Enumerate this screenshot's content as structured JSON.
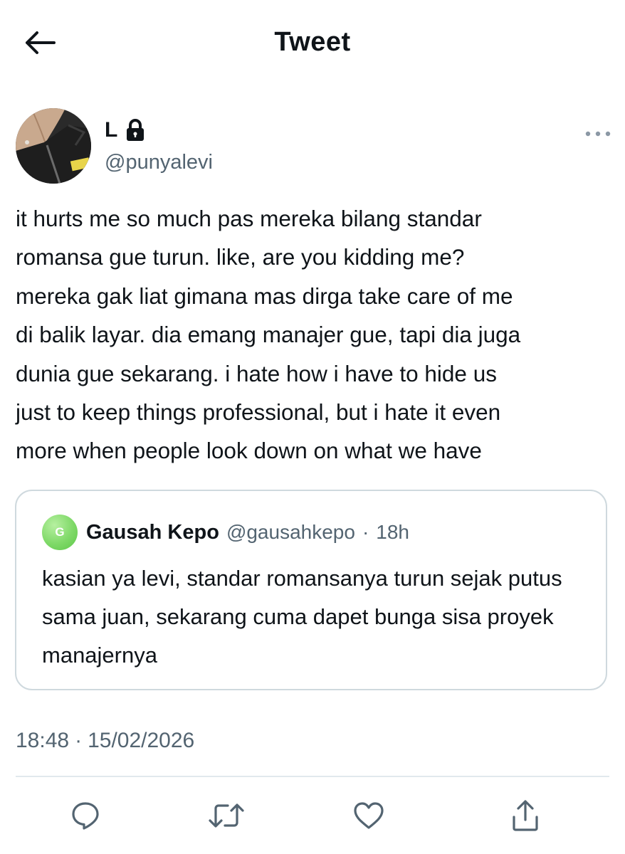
{
  "header": {
    "title": "Tweet"
  },
  "author": {
    "name": "L",
    "handle": "@punyalevi"
  },
  "tweet": {
    "text": "it hurts me so much pas mereka bilang standar\nromansa gue turun. like, are you kidding me?\nmereka gak liat gimana mas dirga take care of me\ndi balik layar. dia emang manajer gue, tapi dia juga\ndunia gue sekarang. i hate how i have to hide us\njust to keep things professional, but i hate it even\nmore when people look down on what we have"
  },
  "quote": {
    "avatar_letter": "G",
    "name": "Gausah Kepo",
    "handle": "@gausahkepo",
    "separator": "·",
    "time": "18h",
    "text": "kasian ya levi, standar romansanya turun sejak putus sama juan, sekarang cuma dapet bunga sisa proyek manajernya"
  },
  "meta": {
    "time": "18:48",
    "separator": "·",
    "date": "15/02/2026"
  },
  "icons": {
    "back": "arrow-left-icon",
    "lock": "lock-icon",
    "more": "more-horizontal-icon",
    "reply": "reply-icon",
    "retweet": "retweet-icon",
    "like": "heart-icon",
    "share": "share-icon"
  },
  "colors": {
    "text": "#0f1419",
    "secondary": "#536471",
    "border": "#cfd9de",
    "quote_avatar": "#7fd968"
  }
}
